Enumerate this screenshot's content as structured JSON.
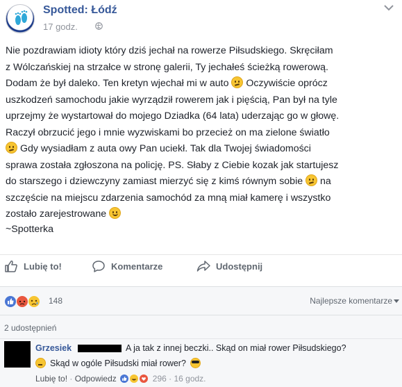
{
  "page": {
    "name": "Spotted: Łódź",
    "time": "17 godz.",
    "privacy_icon": "globe-icon",
    "menu_icon": "chevron-down-icon"
  },
  "post": {
    "lines": [
      "Nie pozdrawiam idioty który dziś jechał na rowerze Piłsudskiego. Skręciłam",
      "z Wólczańskiej na strzałce w stronę galerii, Ty jechałeś ścieżką rowerową.",
      "Dodam że był daleko. Ten kretyn wjechał mi w auto",
      "Oczywiście oprócz",
      "uszkodzeń samochodu jakie wyrządził rowerem jak i pięścią, Pan był na tyle",
      "uprzejmy że wystartował do mojego Dziadka (64 lata) uderzając go w głowę.",
      "Raczył obrzucić jego i mnie wyzwiskami bo przecież on ma zielone światło",
      "Gdy wysiadłam z auta owy Pan uciekł. Tak dla Twojej świadomości",
      "sprawa została zgłoszona na policję. PS. Słaby z Ciebie kozak jak startujesz",
      "do starszego i dziewczyny zamiast mierzyć się z kimś równym sobie",
      "na",
      "szczęście na miejscu zdarzenia samochód za mną miał kamerę i wszystko",
      "zostało zarejestrowane"
    ],
    "signature": "~Spotterka"
  },
  "actions": {
    "like": "Lubię to!",
    "comment": "Komentarze",
    "share": "Udostępnij"
  },
  "reactions": {
    "count": "148",
    "sort": "Najlepsze komentarze"
  },
  "shares": {
    "label": "2 udostępnień"
  },
  "comment": {
    "author": "Grzesiek",
    "text_line1": "A ja tak z innej beczki.. Skąd on miał rower Piłsudskiego?",
    "text_line2": "Skąd w ogóle Piłsudski miał rower?",
    "like": "Lubię to!",
    "reply": "Odpowiedz",
    "reaction_count": "296",
    "time": "16 godz."
  },
  "colors": {
    "link": "#365899",
    "muted": "#90949c",
    "like_blue": "#4a76d4",
    "angry_red": "#e9573f"
  }
}
